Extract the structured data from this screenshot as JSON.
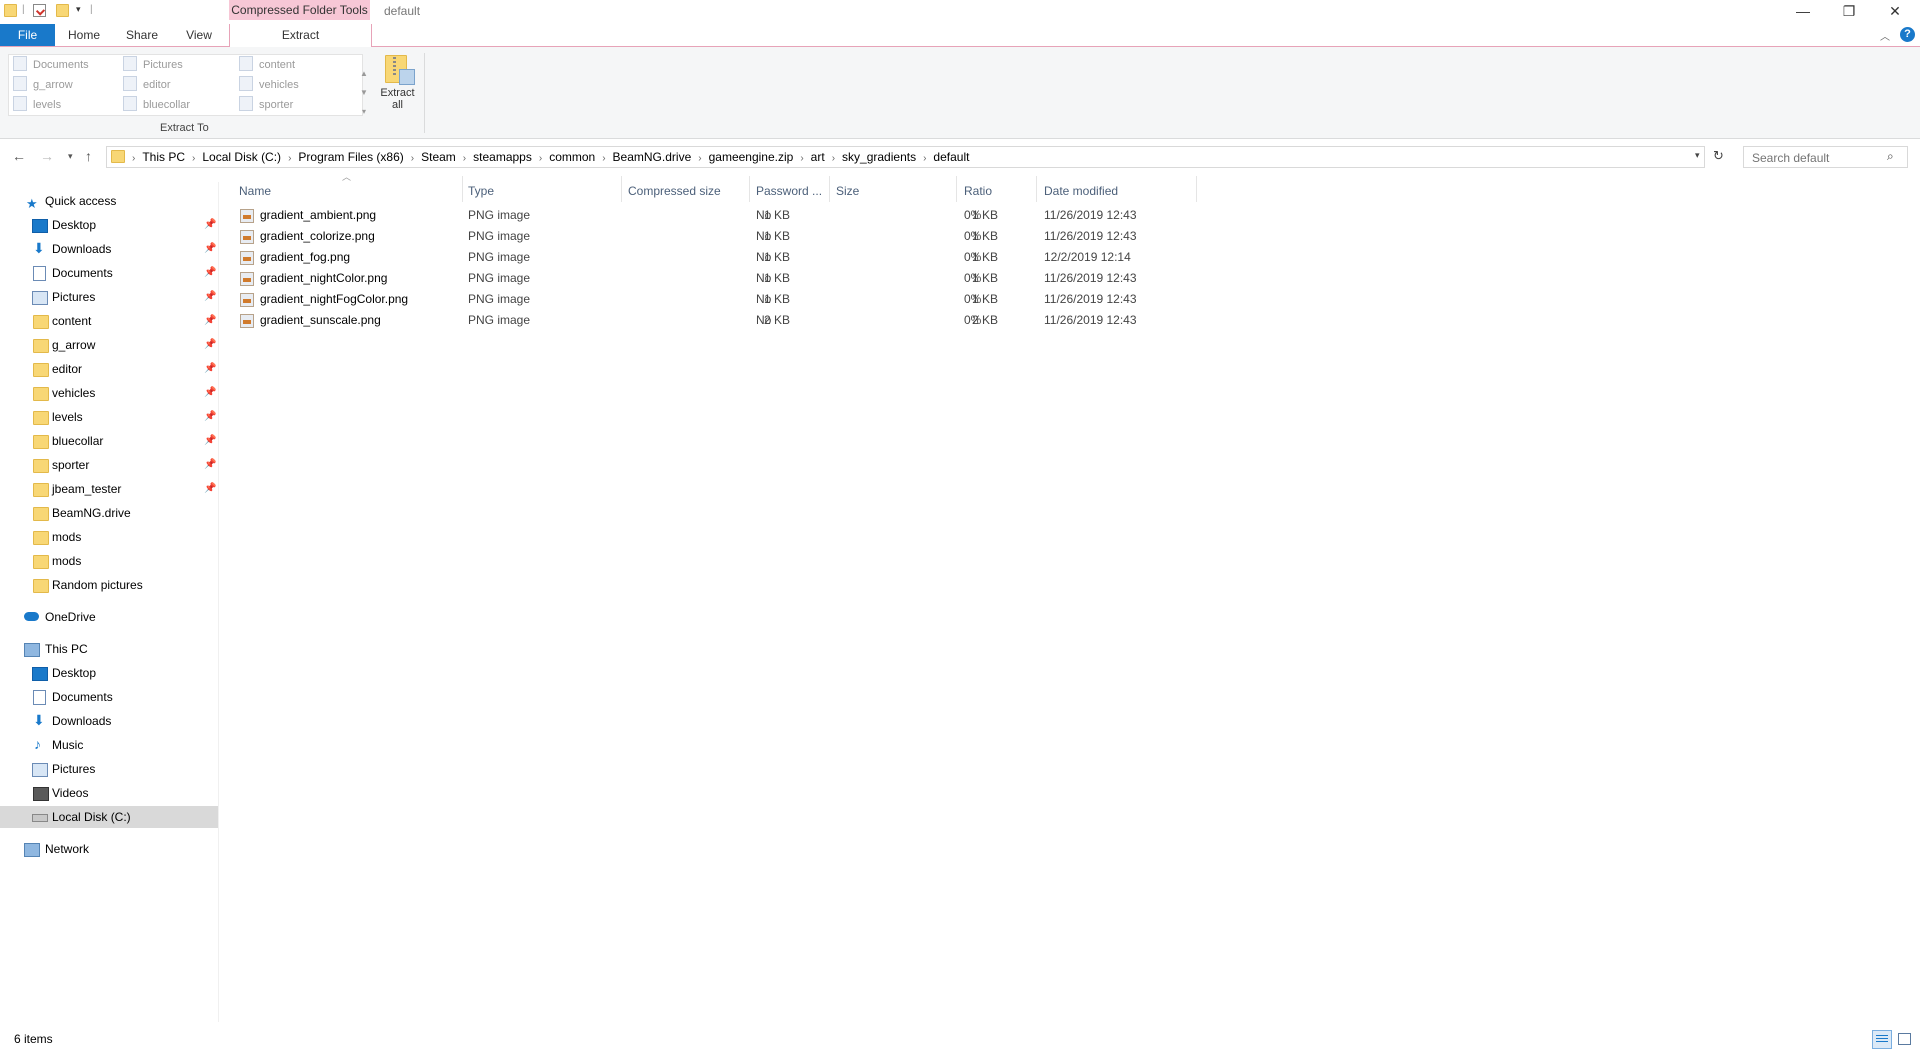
{
  "titlebar": {
    "context_tab": "Compressed Folder Tools",
    "title": "default",
    "minimize": "—",
    "restore": "❐",
    "close": "✕"
  },
  "ribbon_tabs": {
    "file": "File",
    "home": "Home",
    "share": "Share",
    "view": "View",
    "extract": "Extract"
  },
  "ribbon": {
    "extract_to_label": "Extract To",
    "destinations": [
      "Documents",
      "Pictures",
      "content",
      "g_arrow",
      "editor",
      "vehicles",
      "levels",
      "bluecollar",
      "sporter"
    ],
    "extract_all": "Extract all"
  },
  "address": {
    "crumbs": [
      "This PC",
      "Local Disk (C:)",
      "Program Files (x86)",
      "Steam",
      "steamapps",
      "common",
      "BeamNG.drive",
      "gameengine.zip",
      "art",
      "sky_gradients",
      "default"
    ],
    "search_placeholder": "Search default"
  },
  "sidebar": {
    "quick_access": "Quick access",
    "quick_items": [
      {
        "label": "Desktop",
        "icon": "desktop-icon",
        "pinned": true
      },
      {
        "label": "Downloads",
        "icon": "downloads-icon",
        "pinned": true
      },
      {
        "label": "Documents",
        "icon": "documents-icon",
        "pinned": true
      },
      {
        "label": "Pictures",
        "icon": "pictures-icon",
        "pinned": true
      },
      {
        "label": "content",
        "icon": "folder-icon",
        "pinned": true
      },
      {
        "label": "g_arrow",
        "icon": "folder-icon",
        "pinned": true
      },
      {
        "label": "editor",
        "icon": "folder-icon",
        "pinned": true
      },
      {
        "label": "vehicles",
        "icon": "folder-icon",
        "pinned": true
      },
      {
        "label": "levels",
        "icon": "folder-icon",
        "pinned": true
      },
      {
        "label": "bluecollar",
        "icon": "folder-icon",
        "pinned": true
      },
      {
        "label": "sporter",
        "icon": "folder-icon",
        "pinned": true
      },
      {
        "label": "jbeam_tester",
        "icon": "folder-icon",
        "pinned": true
      },
      {
        "label": "BeamNG.drive",
        "icon": "folder-icon",
        "pinned": false
      },
      {
        "label": "mods",
        "icon": "folder-icon",
        "pinned": false
      },
      {
        "label": "mods",
        "icon": "folder-icon",
        "pinned": false
      },
      {
        "label": "Random pictures",
        "icon": "folder-icon",
        "pinned": false
      }
    ],
    "onedrive": "OneDrive",
    "this_pc": "This PC",
    "pc_items": [
      {
        "label": "Desktop",
        "icon": "desktop-icon"
      },
      {
        "label": "Documents",
        "icon": "documents-icon"
      },
      {
        "label": "Downloads",
        "icon": "downloads-icon"
      },
      {
        "label": "Music",
        "icon": "music-icon"
      },
      {
        "label": "Pictures",
        "icon": "pictures-icon"
      },
      {
        "label": "Videos",
        "icon": "videos-icon"
      },
      {
        "label": "Local Disk (C:)",
        "icon": "drive-icon",
        "selected": true
      }
    ],
    "network": "Network"
  },
  "columns": [
    "Name",
    "Type",
    "Compressed size",
    "Password ...",
    "Size",
    "Ratio",
    "Date modified"
  ],
  "files": [
    {
      "name": "gradient_ambient.png",
      "type": "PNG image",
      "compressed": "1 KB",
      "password": "No",
      "size": "1 KB",
      "ratio": "0%",
      "date": "11/26/2019 12:43"
    },
    {
      "name": "gradient_colorize.png",
      "type": "PNG image",
      "compressed": "1 KB",
      "password": "No",
      "size": "1 KB",
      "ratio": "0%",
      "date": "11/26/2019 12:43"
    },
    {
      "name": "gradient_fog.png",
      "type": "PNG image",
      "compressed": "1 KB",
      "password": "No",
      "size": "1 KB",
      "ratio": "0%",
      "date": "12/2/2019 12:14"
    },
    {
      "name": "gradient_nightColor.png",
      "type": "PNG image",
      "compressed": "1 KB",
      "password": "No",
      "size": "1 KB",
      "ratio": "0%",
      "date": "11/26/2019 12:43"
    },
    {
      "name": "gradient_nightFogColor.png",
      "type": "PNG image",
      "compressed": "1 KB",
      "password": "No",
      "size": "1 KB",
      "ratio": "0%",
      "date": "11/26/2019 12:43"
    },
    {
      "name": "gradient_sunscale.png",
      "type": "PNG image",
      "compressed": "2 KB",
      "password": "No",
      "size": "2 KB",
      "ratio": "0%",
      "date": "11/26/2019 12:43"
    }
  ],
  "status": {
    "count": "6 items"
  },
  "colors": {
    "accent": "#1979ca",
    "context_tab": "#f7c7d6",
    "selection": "#d9d9d9",
    "folder": "#f8d775"
  }
}
